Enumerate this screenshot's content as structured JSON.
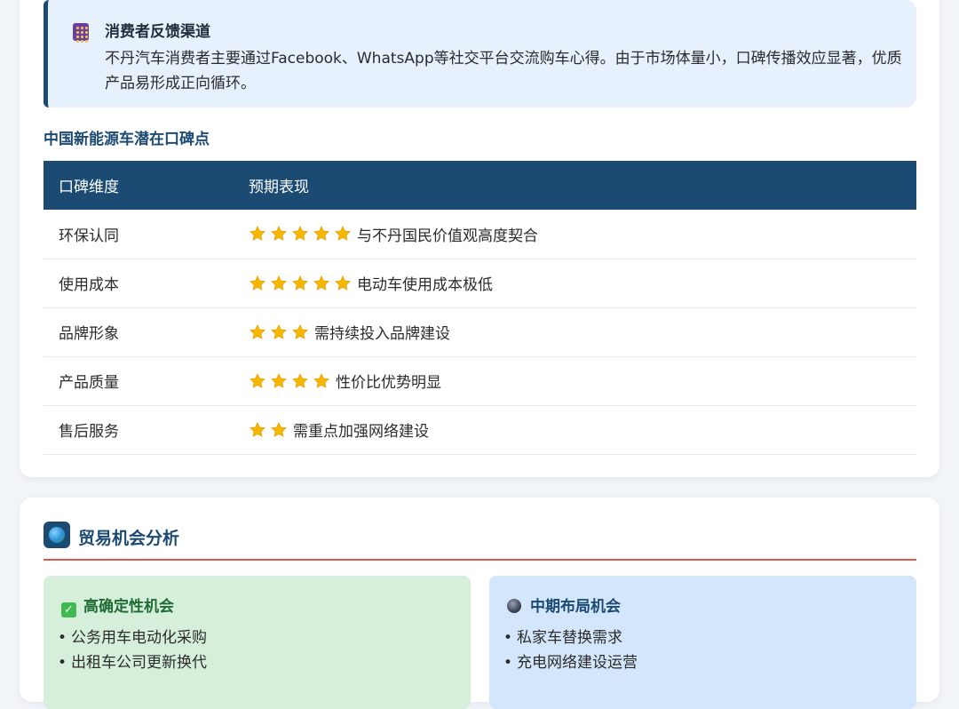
{
  "feedback": {
    "title": "消费者反馈渠道",
    "text": "不丹汽车消费者主要通过Facebook、WhatsApp等社交平台交流购车心得。由于市场体量小，口碑传播效应显著，优质产品易形成正向循环。",
    "icon": "abacus-icon"
  },
  "reputation": {
    "subtitle": "中国新能源车潜在口碑点",
    "columns": [
      "口碑维度",
      "预期表现"
    ],
    "rows": [
      {
        "dimension": "环保认同",
        "stars": 5,
        "text": "与不丹国民价值观高度契合"
      },
      {
        "dimension": "使用成本",
        "stars": 5,
        "text": "电动车使用成本极低"
      },
      {
        "dimension": "品牌形象",
        "stars": 3,
        "text": "需持续投入品牌建设"
      },
      {
        "dimension": "产品质量",
        "stars": 4,
        "text": "性价比优势明显"
      },
      {
        "dimension": "售后服务",
        "stars": 2,
        "text": "需重点加强网络建设"
      }
    ],
    "star_color": "#f5b700"
  },
  "trade": {
    "title": "贸易机会分析",
    "icon": "globe-icon",
    "high": {
      "title": "高确定性机会",
      "icon": "check-icon",
      "items": [
        "公务用车电动化采购",
        "出租车公司更新换代"
      ]
    },
    "mid": {
      "title": "中期布局机会",
      "icon": "crystal-ball-icon",
      "items": [
        "私家车替换需求",
        "充电网络建设运营"
      ]
    }
  },
  "colors": {
    "primary": "#1b4a72",
    "accent_rule": "#e0594b",
    "callout_bg": "#e7f1fd",
    "high_bg": "#d6efdb",
    "mid_bg": "#d3e6fb"
  }
}
